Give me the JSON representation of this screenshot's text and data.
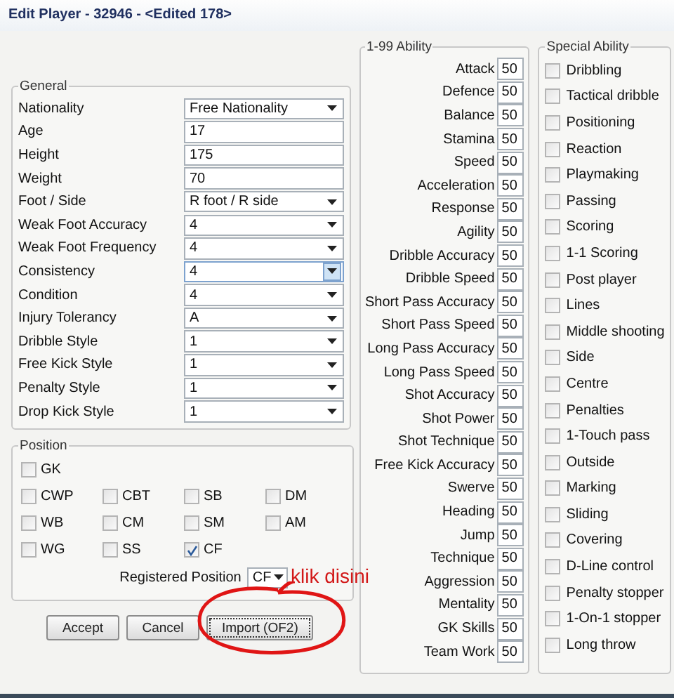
{
  "window": {
    "title": "Edit Player - 32946 - <Edited 178>"
  },
  "general": {
    "title": "General",
    "fields": [
      {
        "label": "Nationality",
        "kind": "select",
        "value": "Free Nationality",
        "focused": false
      },
      {
        "label": "Age",
        "kind": "text",
        "value": "17"
      },
      {
        "label": "Height",
        "kind": "text",
        "value": "175"
      },
      {
        "label": "Weight",
        "kind": "text",
        "value": "70"
      },
      {
        "label": "Foot / Side",
        "kind": "select",
        "value": "R foot / R side",
        "focused": false
      },
      {
        "label": "Weak Foot Accuracy",
        "kind": "select",
        "value": "4",
        "focused": false
      },
      {
        "label": "Weak Foot Frequency",
        "kind": "select",
        "value": "4",
        "focused": false
      },
      {
        "label": "Consistency",
        "kind": "select",
        "value": "4",
        "focused": true
      },
      {
        "label": "Condition",
        "kind": "select",
        "value": "4",
        "focused": false
      },
      {
        "label": "Injury Tolerancy",
        "kind": "select",
        "value": "A",
        "focused": false
      },
      {
        "label": "Dribble Style",
        "kind": "select",
        "value": "1",
        "focused": false
      },
      {
        "label": "Free Kick Style",
        "kind": "select",
        "value": "1",
        "focused": false
      },
      {
        "label": "Penalty Style",
        "kind": "select",
        "value": "1",
        "focused": false
      },
      {
        "label": "Drop Kick Style",
        "kind": "select",
        "value": "1",
        "focused": false
      }
    ]
  },
  "position": {
    "title": "Position",
    "rows": [
      [
        {
          "label": "GK",
          "checked": false
        }
      ],
      [
        {
          "label": "CWP",
          "checked": false
        },
        {
          "label": "CBT",
          "checked": false
        },
        {
          "label": "SB",
          "checked": false
        },
        {
          "label": "DM",
          "checked": false
        }
      ],
      [
        {
          "label": "WB",
          "checked": false
        },
        {
          "label": "CM",
          "checked": false
        },
        {
          "label": "SM",
          "checked": false
        },
        {
          "label": "AM",
          "checked": false
        }
      ],
      [
        {
          "label": "WG",
          "checked": false
        },
        {
          "label": "SS",
          "checked": false
        },
        {
          "label": "CF",
          "checked": true
        }
      ]
    ],
    "registered_label": "Registered Position",
    "registered_value": "CF"
  },
  "buttons": [
    {
      "label": "Accept",
      "focused": false
    },
    {
      "label": "Cancel",
      "focused": false
    },
    {
      "label": "Import (OF2)",
      "focused": true
    }
  ],
  "annotation": {
    "text": "klik disini"
  },
  "ability": {
    "title": "1-99 Ability",
    "rows": [
      {
        "label": "Attack",
        "value": "50"
      },
      {
        "label": "Defence",
        "value": "50"
      },
      {
        "label": "Balance",
        "value": "50"
      },
      {
        "label": "Stamina",
        "value": "50"
      },
      {
        "label": "Speed",
        "value": "50"
      },
      {
        "label": "Acceleration",
        "value": "50"
      },
      {
        "label": "Response",
        "value": "50"
      },
      {
        "label": "Agility",
        "value": "50"
      },
      {
        "label": "Dribble Accuracy",
        "value": "50"
      },
      {
        "label": "Dribble Speed",
        "value": "50"
      },
      {
        "label": "Short Pass Accuracy",
        "value": "50"
      },
      {
        "label": "Short Pass Speed",
        "value": "50"
      },
      {
        "label": "Long Pass Accuracy",
        "value": "50"
      },
      {
        "label": "Long Pass Speed",
        "value": "50"
      },
      {
        "label": "Shot Accuracy",
        "value": "50"
      },
      {
        "label": "Shot Power",
        "value": "50"
      },
      {
        "label": "Shot Technique",
        "value": "50"
      },
      {
        "label": "Free Kick Accuracy",
        "value": "50"
      },
      {
        "label": "Swerve",
        "value": "50"
      },
      {
        "label": "Heading",
        "value": "50"
      },
      {
        "label": "Jump",
        "value": "50"
      },
      {
        "label": "Technique",
        "value": "50"
      },
      {
        "label": "Aggression",
        "value": "50"
      },
      {
        "label": "Mentality",
        "value": "50"
      },
      {
        "label": "GK Skills",
        "value": "50"
      },
      {
        "label": "Team Work",
        "value": "50"
      }
    ]
  },
  "special": {
    "title": "Special Ability",
    "items": [
      {
        "label": "Dribbling",
        "checked": false
      },
      {
        "label": "Tactical dribble",
        "checked": false
      },
      {
        "label": "Positioning",
        "checked": false
      },
      {
        "label": "Reaction",
        "checked": false
      },
      {
        "label": "Playmaking",
        "checked": false
      },
      {
        "label": "Passing",
        "checked": false
      },
      {
        "label": "Scoring",
        "checked": false
      },
      {
        "label": "1-1 Scoring",
        "checked": false
      },
      {
        "label": "Post player",
        "checked": false
      },
      {
        "label": "Lines",
        "checked": false
      },
      {
        "label": "Middle shooting",
        "checked": false
      },
      {
        "label": "Side",
        "checked": false
      },
      {
        "label": "Centre",
        "checked": false
      },
      {
        "label": "Penalties",
        "checked": false
      },
      {
        "label": "1-Touch pass",
        "checked": false
      },
      {
        "label": "Outside",
        "checked": false
      },
      {
        "label": "Marking",
        "checked": false
      },
      {
        "label": "Sliding",
        "checked": false
      },
      {
        "label": "Covering",
        "checked": false
      },
      {
        "label": "D-Line control",
        "checked": false
      },
      {
        "label": "Penalty stopper",
        "checked": false
      },
      {
        "label": "1-On-1 stopper",
        "checked": false
      },
      {
        "label": "Long throw",
        "checked": false
      }
    ]
  }
}
